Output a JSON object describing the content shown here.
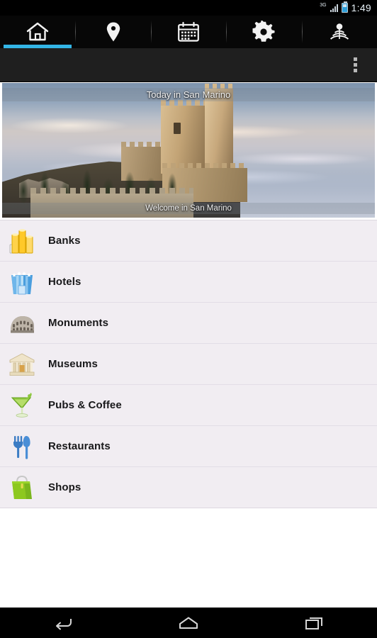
{
  "status_bar": {
    "network": "3G",
    "network_icon": "signal-3g-icon",
    "battery_icon": "battery-icon",
    "clock": "1:49"
  },
  "tabs": [
    {
      "id": "home",
      "icon": "home-icon",
      "label": "Home",
      "active": true
    },
    {
      "id": "map",
      "icon": "map-pin-icon",
      "label": "Map",
      "active": false
    },
    {
      "id": "events",
      "icon": "calendar-icon",
      "label": "Events",
      "active": false
    },
    {
      "id": "settings",
      "icon": "gear-icon",
      "label": "Settings",
      "active": false
    },
    {
      "id": "radar",
      "icon": "radar-icon",
      "label": "Radar",
      "active": false
    }
  ],
  "action_bar": {
    "overflow_icon": "overflow-menu-icon",
    "overflow_label": "More options"
  },
  "banner": {
    "title": "Today in San Marino",
    "caption": "Welcome in San Marino",
    "image_alt": "Guaita fortress of San Marino above a sea of clouds"
  },
  "categories": [
    {
      "label": "Banks",
      "icon": "banks-coins-icon"
    },
    {
      "label": "Hotels",
      "icon": "hotel-building-icon"
    },
    {
      "label": "Monuments",
      "icon": "colosseum-icon"
    },
    {
      "label": "Museums",
      "icon": "museum-columns-icon"
    },
    {
      "label": "Pubs & Coffee",
      "icon": "cocktail-glass-icon"
    },
    {
      "label": "Restaurants",
      "icon": "fork-knife-icon"
    },
    {
      "label": "Shops",
      "icon": "shopping-bag-icon"
    }
  ],
  "navigation_bar": [
    {
      "id": "back",
      "icon": "back-arrow-icon",
      "label": "Back"
    },
    {
      "id": "home",
      "icon": "home-nav-icon",
      "label": "Home"
    },
    {
      "id": "recents",
      "icon": "recent-apps-icon",
      "label": "Recent apps"
    }
  ],
  "colors": {
    "accent": "#33b5e5",
    "list_bg": "#f1edf2",
    "action_bar": "#1f1f1f",
    "tab_bar": "#070707"
  }
}
